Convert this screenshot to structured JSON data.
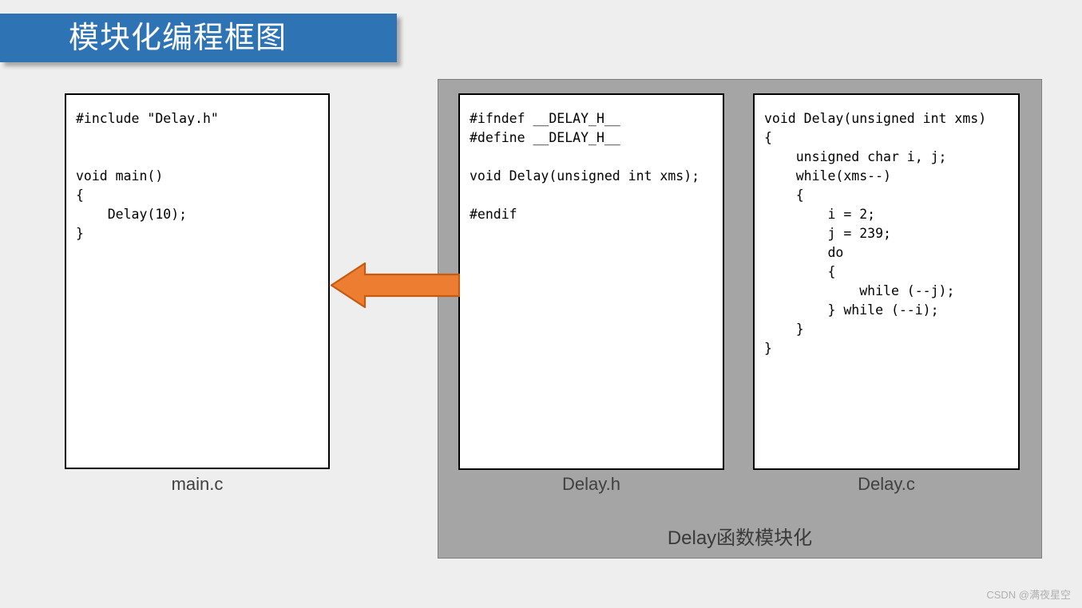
{
  "page": {
    "background_color": "#eeeeee"
  },
  "title_banner": {
    "text": "模块化编程框图",
    "background_color": "#2e74b5",
    "text_color": "#ffffff"
  },
  "boxes": {
    "mainc": {
      "caption": "main.c",
      "code": "#include \"Delay.h\"\n\n\nvoid main()\n{\n    Delay(10);\n}"
    },
    "delayh": {
      "caption": "Delay.h",
      "code": "#ifndef __DELAY_H__\n#define __DELAY_H__\n\nvoid Delay(unsigned int xms);\n\n#endif"
    },
    "delayc": {
      "caption": "Delay.c",
      "code": "void Delay(unsigned int xms)\n{\n    unsigned char i, j;\n    while(xms--)\n    {\n        i = 2;\n        j = 239;\n        do\n        {\n            while (--j);\n        } while (--i);\n    }\n}"
    }
  },
  "module_container": {
    "caption": "Delay函数模块化",
    "background_color": "#a5a5a5"
  },
  "arrow": {
    "name": "left-arrow",
    "direction": "left",
    "fill_color": "#ed7d31",
    "stroke_color": "#c55a11"
  },
  "watermark": {
    "text": "CSDN @满夜星空"
  }
}
